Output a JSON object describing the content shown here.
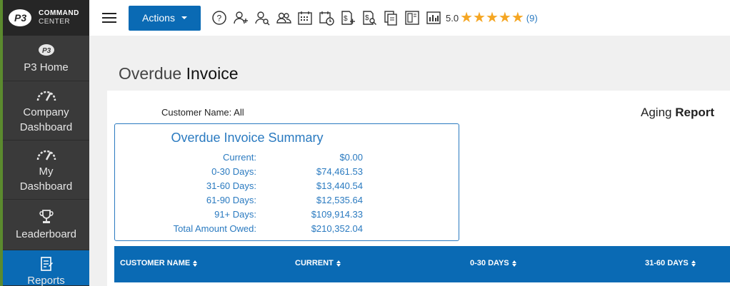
{
  "brand": {
    "line1": "COMMAND",
    "line2": "CENTER"
  },
  "sidebar": {
    "items": [
      {
        "label": "P3 Home",
        "icon": "p3-logo-icon"
      },
      {
        "label": "Company Dashboard",
        "icon": "gauge-icon"
      },
      {
        "label": "My Dashboard",
        "icon": "gauge-icon"
      },
      {
        "label": "Leaderboard",
        "icon": "trophy-icon"
      },
      {
        "label": "Reports",
        "icon": "report-icon"
      }
    ]
  },
  "toolbar": {
    "actions_label": "Actions",
    "icons": [
      "help-icon",
      "add-user-icon",
      "search-user-icon",
      "group-icon",
      "calendar-icon",
      "schedule-icon",
      "invoice-add-icon",
      "invoice-search-icon",
      "copy-icon",
      "layout-icon",
      "chart-icon"
    ],
    "rating": "5.0",
    "stars": 5,
    "rating_count": "(9)"
  },
  "page": {
    "title_light": "Overdue",
    "title_bold": "Invoice",
    "customer_label": "Customer Name:",
    "customer_value": "All",
    "aging_light": "Aging",
    "aging_bold": "Report"
  },
  "summary": {
    "title": "Overdue Invoice Summary",
    "rows": [
      {
        "label": "Current:",
        "value": "$0.00"
      },
      {
        "label": "0-30 Days:",
        "value": "$74,461.53"
      },
      {
        "label": "31-60 Days:",
        "value": "$13,440.54"
      },
      {
        "label": "61-90 Days:",
        "value": "$12,535.64"
      },
      {
        "label": "91+ Days:",
        "value": "$109,914.33"
      },
      {
        "label": "Total Amount Owed:",
        "value": "$210,352.04"
      }
    ]
  },
  "table": {
    "columns": [
      "CUSTOMER NAME",
      "CURRENT",
      "0-30 DAYS",
      "31-60 DAYS"
    ]
  },
  "colors": {
    "accent": "#0a6ab4",
    "link": "#2a7ac0",
    "star": "#f5a623",
    "sidebar": "#3a3a3a"
  }
}
